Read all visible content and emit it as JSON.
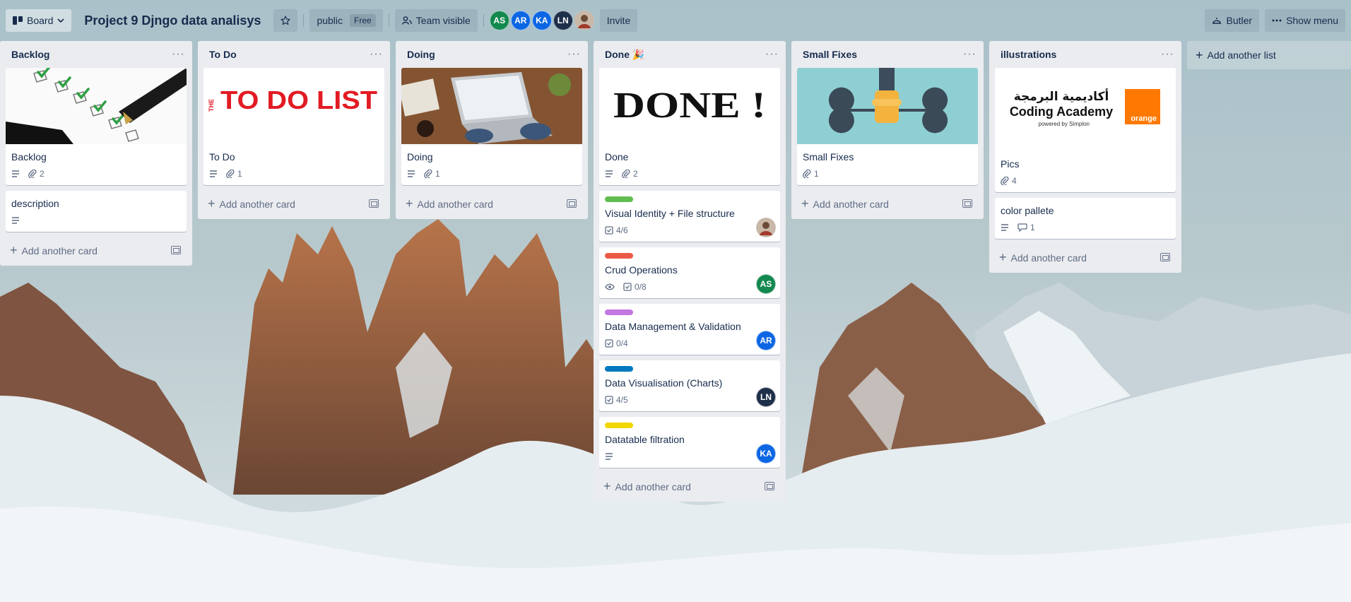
{
  "header": {
    "board_switch_label": "Board",
    "board_title": "Project 9 Djngo data analisys",
    "visibility_label": "public",
    "plan_badge": "Free",
    "team_label": "Team visible",
    "members": [
      {
        "initials": "AS",
        "color": "#13884f"
      },
      {
        "initials": "AR",
        "color": "#0c66e4"
      },
      {
        "initials": "KA",
        "color": "#0c66e4"
      },
      {
        "initials": "LN",
        "color": "#1e2f4a"
      },
      {
        "initials": "",
        "color": "#8a6d5a"
      }
    ],
    "invite_label": "Invite",
    "butler_label": "Butler",
    "show_menu_label": "Show menu"
  },
  "lists": [
    {
      "title": "Backlog",
      "cards": [
        {
          "title": "Backlog",
          "attachments": "2"
        },
        {
          "title": "description"
        }
      ],
      "add_card_label": "Add another card"
    },
    {
      "title": "To Do",
      "cards": [
        {
          "title": "To Do",
          "attachments": "1",
          "cover_text": "TO DO LIST",
          "cover_small": "THE"
        }
      ],
      "add_card_label": "Add another card"
    },
    {
      "title": "Doing",
      "cards": [
        {
          "title": "Doing",
          "attachments": "1"
        }
      ],
      "add_card_label": "Add another card"
    },
    {
      "title": "Done",
      "title_emoji": "🎉",
      "cards": [
        {
          "title": "Done",
          "attachments": "2",
          "cover_text": "DONE !"
        },
        {
          "title": "Visual Identity + File structure",
          "label_color": "#61bd4f",
          "checklist": "4/6"
        },
        {
          "title": "Crud Operations",
          "label_color": "#eb5a46",
          "checklist": "0/8",
          "member": "AS",
          "member_color": "#13884f"
        },
        {
          "title": "Data Management & Validation",
          "label_color": "#c377e0",
          "checklist": "0/4",
          "member": "AR",
          "member_color": "#0c66e4"
        },
        {
          "title": "Data Visualisation (Charts)",
          "label_color": "#0079bf",
          "checklist": "4/5",
          "member": "LN",
          "member_color": "#1e2f4a"
        },
        {
          "title": "Datatable filtration",
          "label_color": "#f2d600",
          "member": "KA",
          "member_color": "#0c66e4"
        }
      ],
      "add_card_label": "Add another card"
    },
    {
      "title": "Small Fixes",
      "cards": [
        {
          "title": "Small Fixes",
          "attachments": "1"
        }
      ],
      "add_card_label": "Add another card"
    },
    {
      "title": "illustrations",
      "cards": [
        {
          "title": "Pics",
          "attachments": "4",
          "cover_arabic": "أكاديمية البرمجة",
          "cover_brand": "Coding Academy",
          "cover_powered": "powered by Simplon",
          "cover_logo": "orange"
        },
        {
          "title": "color pallete",
          "comments": "1"
        }
      ],
      "add_card_label": "Add another card"
    }
  ],
  "add_list_label": "Add another list"
}
